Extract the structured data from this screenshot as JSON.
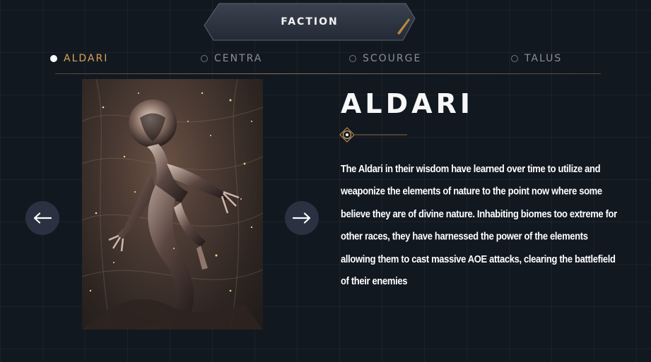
{
  "header": {
    "title": "FACTION"
  },
  "tabs": [
    {
      "label": "ALDARI",
      "active": true
    },
    {
      "label": "CENTRA",
      "active": false
    },
    {
      "label": "SCOURGE",
      "active": false
    },
    {
      "label": "TALUS",
      "active": false
    }
  ],
  "detail": {
    "name": "ALDARI",
    "description": "The Aldari in their wisdom have learned over time to utilize and weaponize the elements of nature to the point now where some believe they are of divine nature. Inhabiting biomes too extreme for other races, they have harnessed the power of the elements allowing them to cast massive AOE attacks, clearing the battlefield of their enemies"
  },
  "navigation": {
    "prev_icon": "arrow-left-icon",
    "next_icon": "arrow-right-icon"
  },
  "colors": {
    "background": "#121820",
    "active_tab": "#d9a35c",
    "inactive_tab": "#8b9097",
    "arrow_button": "#2a3140",
    "header_tab": "#2b3340"
  }
}
